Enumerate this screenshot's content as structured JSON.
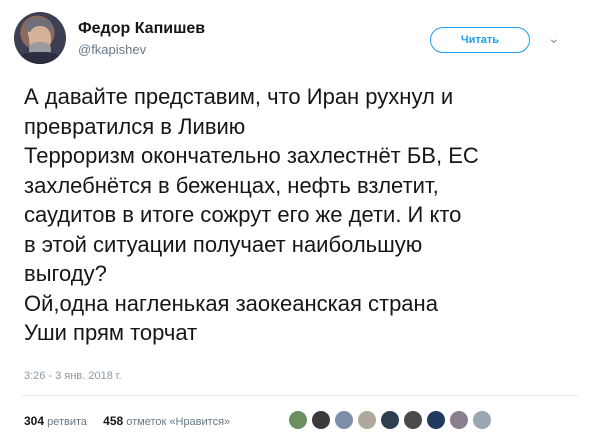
{
  "author": {
    "name": "Федор Капишев",
    "handle": "@fkapishev"
  },
  "follow_button": {
    "label": "Читать"
  },
  "tweet": {
    "lines": [
      "А давайте представим, что Иран рухнул и",
      "превратился в Ливию",
      "Терроризм окончательно захлестнёт БВ, ЕС",
      "захлебнётся в беженцах, нефть взлетит,",
      "саудитов в итоге сожрут его же дети. И кто",
      "в этой ситуации получает наибольшую",
      "выгоду?",
      "Ой,одна нагленькая заокеанская страна",
      "Уши прям торчат"
    ],
    "timestamp": "3:26 - 3 янв. 2018 г."
  },
  "stats": {
    "retweets_count": "304",
    "retweets_label": "ретвита",
    "likes_count": "458",
    "likes_label": "отметок «Нравится»"
  },
  "liker_avatars": [
    {
      "color": "#6b8f5e"
    },
    {
      "color": "#3a3a3a"
    },
    {
      "color": "#7d8fa8"
    },
    {
      "color": "#b0a89c"
    },
    {
      "color": "#2c3e50"
    },
    {
      "color": "#4a4a4a"
    },
    {
      "color": "#1f3a5f"
    },
    {
      "color": "#8a7f8f"
    },
    {
      "color": "#9aa6b2"
    }
  ]
}
